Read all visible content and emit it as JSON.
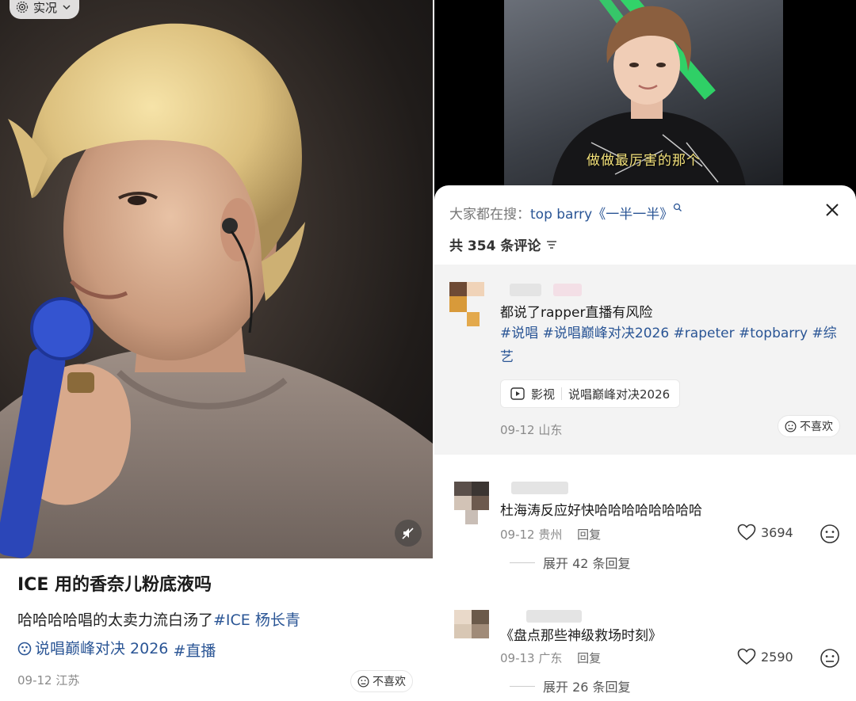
{
  "left_post": {
    "live_badge": "实况",
    "title": "ICE 用的香奈儿粉底液吗",
    "body_text": "哈哈哈哈唱的太卖力流白汤了",
    "tag_1": "#ICE 杨长青",
    "topic_tag": "说唱巅峰对决 2026",
    "tag_2": "#直播",
    "date": "09-12",
    "location": "江苏",
    "dislike_label": "不喜欢"
  },
  "right_panel": {
    "video_subtitle": "做做最厉害的那个",
    "search_hint_prefix": "大家都在搜：",
    "search_query": "top barry《一半一半》",
    "comment_count_label": "共 354 条评论",
    "pinned_comment": {
      "text": "都说了rapper直播有风险",
      "tags": "#说唱 #说唱巅峰对决2026 #rapeter #topbarry #综艺",
      "media_type": "影视",
      "media_title": "说唱巅峰对决2026",
      "date": "09-12",
      "location": "山东",
      "dislike_label": "不喜欢"
    },
    "comments": [
      {
        "text": "杜海涛反应好快哈哈哈哈哈哈哈哈",
        "date": "09-12",
        "location": "贵州",
        "reply_label": "回复",
        "likes": "3694",
        "expand_label": "展开 42 条回复"
      },
      {
        "text": "《盘点那些神级救场时刻》",
        "date": "09-13",
        "location": "广东",
        "reply_label": "回复",
        "likes": "2590",
        "expand_label": "展开 26 条回复"
      }
    ]
  },
  "colors": {
    "link_blue": "#2a5595",
    "meta_gray": "#8a8a8a",
    "subtitle_yellow": "#f4e27a",
    "pinned_bg": "#f3f3f3"
  },
  "icons": [
    "live-photo-icon",
    "chevron-down-icon",
    "mute-icon",
    "topic-icon",
    "dislike-face-icon",
    "close-icon",
    "filter-icon",
    "video-play-icon",
    "heart-icon",
    "emoji-icon",
    "search-sparkle-icon"
  ]
}
